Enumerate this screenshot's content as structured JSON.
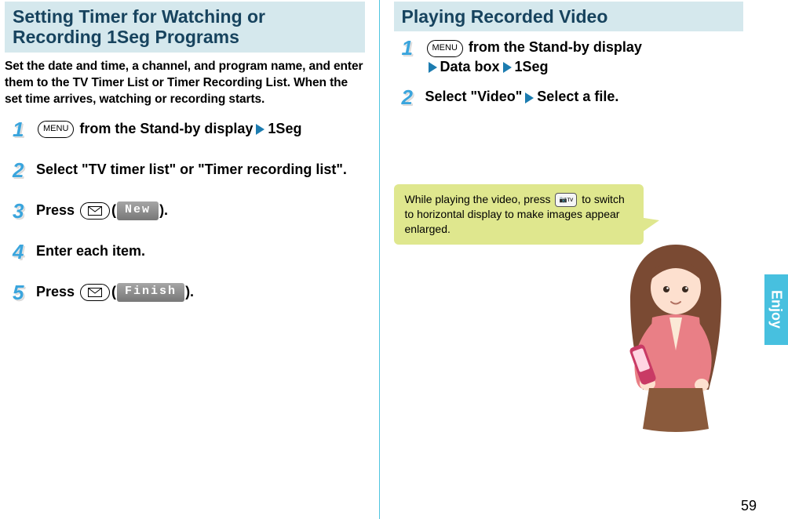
{
  "left": {
    "title": "Setting Timer for Watching or Recording 1Seg Programs",
    "intro": "Set the date and time, a channel, and program name, and enter them to the TV Timer List or Timer Recording List. When the set time arrives, watching or recording starts.",
    "steps": {
      "s1": {
        "num": "1",
        "key": "MENU",
        "t1": " from the Stand-by display",
        "t2": "1Seg"
      },
      "s2": {
        "num": "2",
        "text": "Select \"TV timer list\" or \"Timer recording list\"."
      },
      "s3": {
        "num": "3",
        "pre": "Press ",
        "btn": " New ",
        "post": ")."
      },
      "s4": {
        "num": "4",
        "text": "Enter each item."
      },
      "s5": {
        "num": "5",
        "pre": "Press ",
        "btn": "Finish",
        "post": ")."
      }
    }
  },
  "right": {
    "title": "Playing Recorded Video",
    "steps": {
      "s1": {
        "num": "1",
        "key": "MENU",
        "t1": " from the Stand-by display",
        "a": "Data box",
        "b": "1Seg"
      },
      "s2": {
        "num": "2",
        "t1": "Select \"Video\"",
        "t2": "Select a file."
      }
    },
    "tip": {
      "pre": "While playing the video, press ",
      "keylabel": "📷ᴛᴠ",
      "post": " to switch to horizontal display to make images appear enlarged."
    }
  },
  "sideTab": "Enjoy",
  "pageNumber": "59"
}
